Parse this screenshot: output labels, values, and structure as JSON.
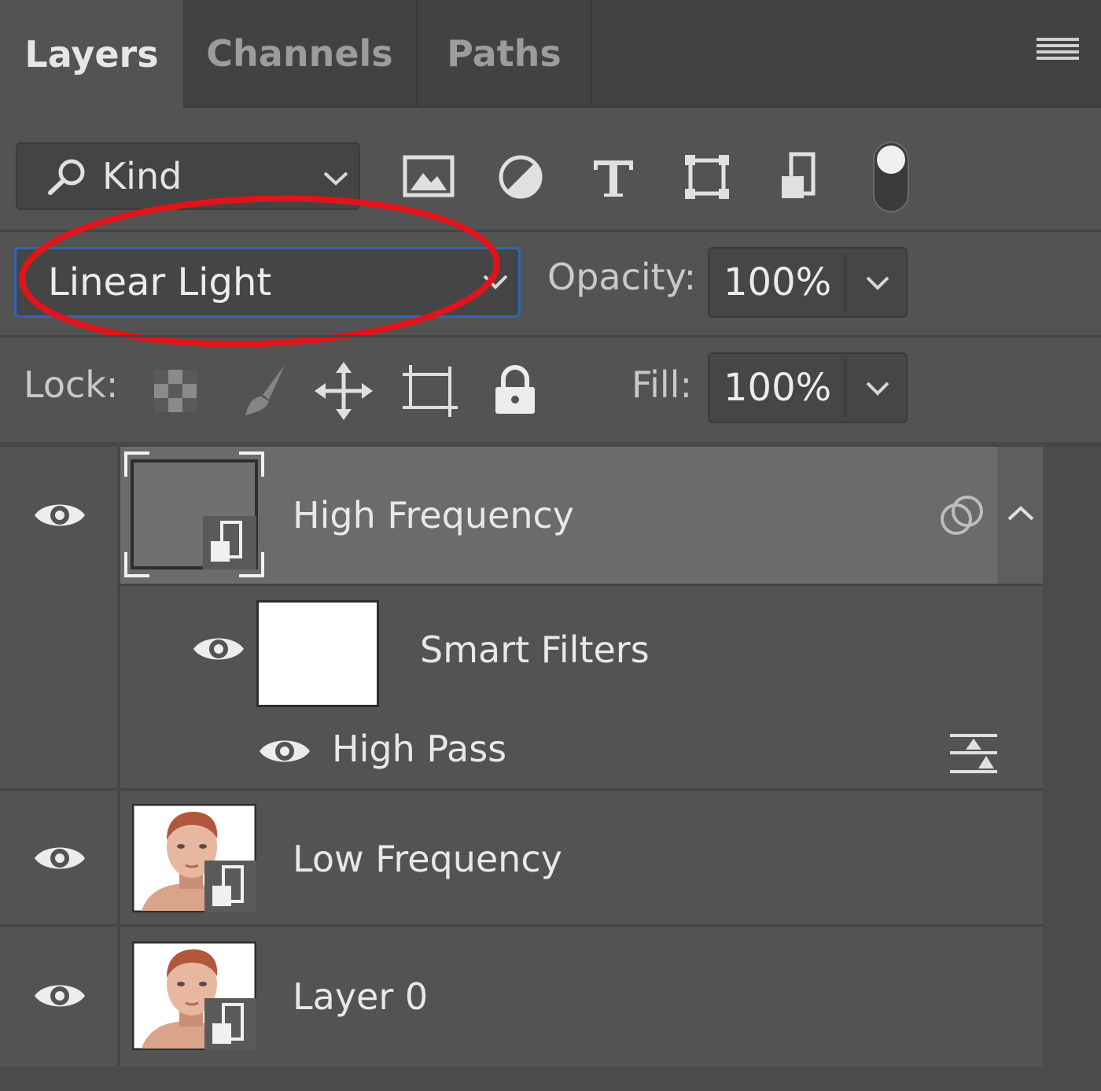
{
  "tabs": [
    {
      "label": "Layers",
      "active": true
    },
    {
      "label": "Channels",
      "active": false
    },
    {
      "label": "Paths",
      "active": false
    }
  ],
  "filter": {
    "kind_label": "Kind",
    "icons": [
      "pixel-layer-filter-icon",
      "adjustment-layer-filter-icon",
      "type-layer-filter-icon",
      "shape-layer-filter-icon",
      "smart-object-filter-icon",
      "filter-toggle-switch"
    ]
  },
  "blend": {
    "mode": "Linear Light",
    "opacity_label": "Opacity:",
    "opacity_value": "100%",
    "annotation_color": "#e0141b"
  },
  "lock": {
    "label": "Lock:",
    "icons": [
      "lock-transparent-pixels-icon",
      "lock-image-pixels-icon",
      "lock-position-icon",
      "lock-artboard-icon",
      "lock-all-icon"
    ],
    "fill_label": "Fill:",
    "fill_value": "100%"
  },
  "layers": [
    {
      "name": "High Frequency",
      "selected": true,
      "visible": true,
      "type": "smart-object"
    },
    {
      "name": "Smart Filters",
      "visible": true,
      "type": "smart-filters"
    },
    {
      "name": "High Pass",
      "visible": true,
      "type": "filter"
    },
    {
      "name": "Low Frequency",
      "visible": true,
      "type": "smart-object"
    },
    {
      "name": "Layer 0",
      "visible": true,
      "type": "smart-object"
    }
  ],
  "colors": {
    "panel_bg": "#535353",
    "tab_bar_bg": "#424242",
    "selected_row": "#6b6b6b",
    "focus_blue": "#2f67b5"
  }
}
